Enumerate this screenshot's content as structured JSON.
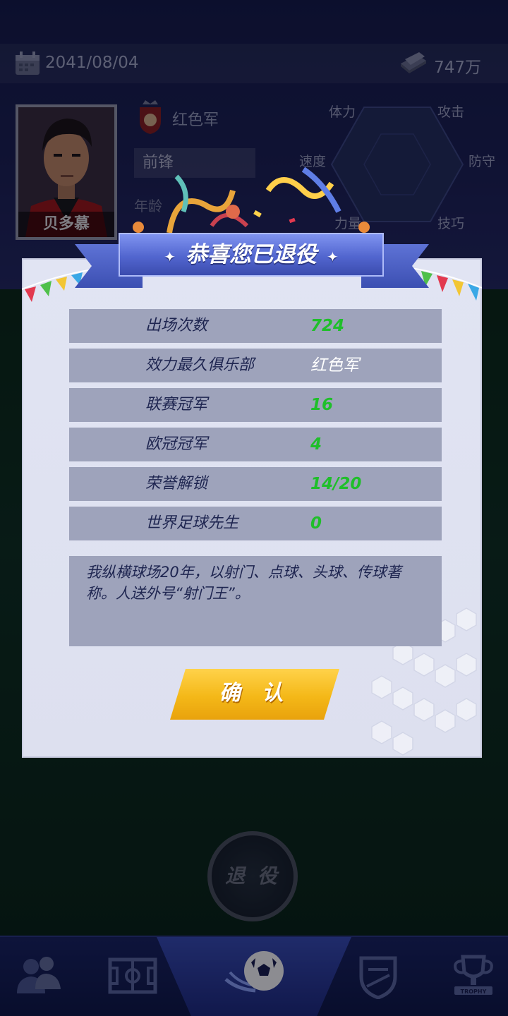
{
  "header": {
    "date": "2041/08/04",
    "money": "747万"
  },
  "player": {
    "name": "贝多慕",
    "club": "红色军",
    "position": "前锋",
    "age_label": "年龄"
  },
  "radar": {
    "labels": [
      "体力",
      "攻击",
      "速度",
      "防守",
      "力量",
      "技巧"
    ]
  },
  "modal": {
    "title": "恭喜您已退役",
    "stats": [
      {
        "label": "出场次数",
        "value": "724"
      },
      {
        "label": "效力最久俱乐部",
        "value": "红色军"
      },
      {
        "label": "联赛冠军",
        "value": "16"
      },
      {
        "label": "欧冠冠军",
        "value": "4"
      },
      {
        "label": "荣誉解锁",
        "value": "14/20"
      },
      {
        "label": "世界足球先生",
        "value": "0"
      }
    ],
    "description": "我纵横球场20年，以射门、点球、头球、传球著称。人送外号“射门王”。",
    "confirm_label": "确 认"
  },
  "retire_button": "退 役",
  "bottom_nav": {
    "items": [
      "team-icon",
      "field-icon",
      "football-icon",
      "shield-icon",
      "trophy-icon"
    ],
    "trophy_text": "TROPHY"
  },
  "colors": {
    "stat_value_green": "#1fbf2a",
    "banner_blue": "#5266cf",
    "confirm_gold": "#f4b818"
  }
}
